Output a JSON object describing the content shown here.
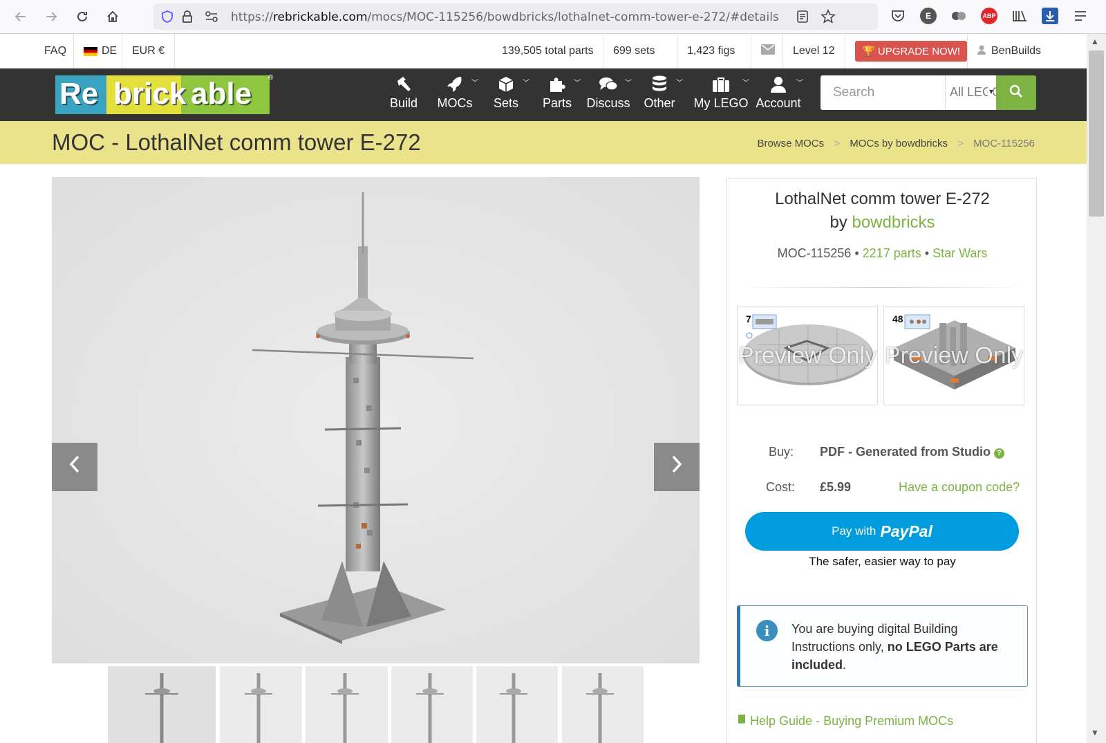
{
  "browser": {
    "url_prefix": "https://",
    "url_domain": "rebrickable.com",
    "url_path": "/mocs/MOC-115256/bowdbricks/lothalnet-comm-tower-e-272/#details",
    "ext_e": "E",
    "ext_abp": "ABP"
  },
  "topbar": {
    "faq": "FAQ",
    "lang": "DE",
    "currency": "EUR €",
    "total_parts": "139,505 total parts",
    "sets": "699 sets",
    "figs": "1,423 figs",
    "level": "Level 12",
    "upgrade": "UPGRADE NOW!",
    "user": "BenBuilds"
  },
  "logo": {
    "part1": "Re",
    "part2": "brick",
    "part3": "able",
    "reg": "®"
  },
  "nav": [
    {
      "label": "Build",
      "icon": "hammer-icon",
      "caret": false
    },
    {
      "label": "MOCs",
      "icon": "rocket-icon",
      "caret": true
    },
    {
      "label": "Sets",
      "icon": "cube-icon",
      "caret": true
    },
    {
      "label": "Parts",
      "icon": "puzzle-icon",
      "caret": true
    },
    {
      "label": "Discuss",
      "icon": "comments-icon",
      "caret": true
    },
    {
      "label": "Other",
      "icon": "database-icon",
      "caret": true
    },
    {
      "label": "My LEGO",
      "icon": "suitcase-icon",
      "caret": true
    },
    {
      "label": "Account",
      "icon": "user-icon",
      "caret": true
    }
  ],
  "search": {
    "placeholder": "Search",
    "scope": "All LEGO"
  },
  "page": {
    "title": "MOC - LothalNet comm tower E-272",
    "breadcrumbs": [
      "Browse MOCs",
      "MOCs by bowdbricks",
      "MOC-115256"
    ]
  },
  "moc": {
    "name": "LothalNet comm tower E-272",
    "by": "by",
    "author": "bowdbricks",
    "id": "MOC-115256",
    "parts": "2217 parts",
    "theme": "Star Wars",
    "bullet": "•",
    "previews": [
      {
        "step": "7",
        "watermark": "Preview Only"
      },
      {
        "step": "48",
        "watermark": "Preview Only"
      }
    ],
    "buy_label": "Buy:",
    "buy_value": "PDF - Generated from Studio",
    "cost_label": "Cost:",
    "cost_value": "£5.99",
    "coupon": "Have a coupon code?",
    "paypal_pay": "Pay with",
    "paypal_brand": "PayPal",
    "paypal_tag": "The safer, easier way to pay",
    "info_text1": "You are buying digital Building Instructions only,",
    "info_bold": "no LEGO Parts are included",
    "info_end": ".",
    "help": "Help Guide - Buying Premium MOCs"
  },
  "colors": {
    "accent_green": "#7cb342",
    "navbar": "#333333",
    "titlebar": "#ebe38b",
    "upgrade_red": "#d9534f",
    "paypal_blue": "#009cde"
  }
}
